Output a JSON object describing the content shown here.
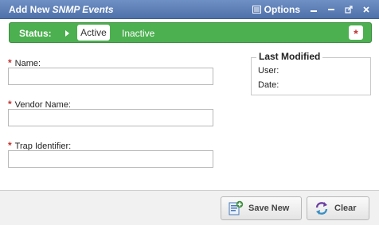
{
  "window": {
    "title_prefix": "Add New ",
    "title_emphasis": "SNMP Events",
    "options_label": "Options"
  },
  "status": {
    "label": "Status:",
    "active_label": "Active",
    "inactive_label": "Inactive",
    "required_marker": "*"
  },
  "form": {
    "required_marker": "*",
    "fields": [
      {
        "label": "Name:",
        "value": ""
      },
      {
        "label": "Vendor Name:",
        "value": ""
      },
      {
        "label": "Trap Identifier:",
        "value": ""
      }
    ]
  },
  "last_modified": {
    "title": "Last Modified",
    "user_label": "User:",
    "date_label": "Date:"
  },
  "footer": {
    "save_new_label": "Save New",
    "clear_label": "Clear"
  },
  "colors": {
    "titlebar": "#5a7bb5",
    "status_green": "#4caf50",
    "required_red": "#c0322f"
  }
}
